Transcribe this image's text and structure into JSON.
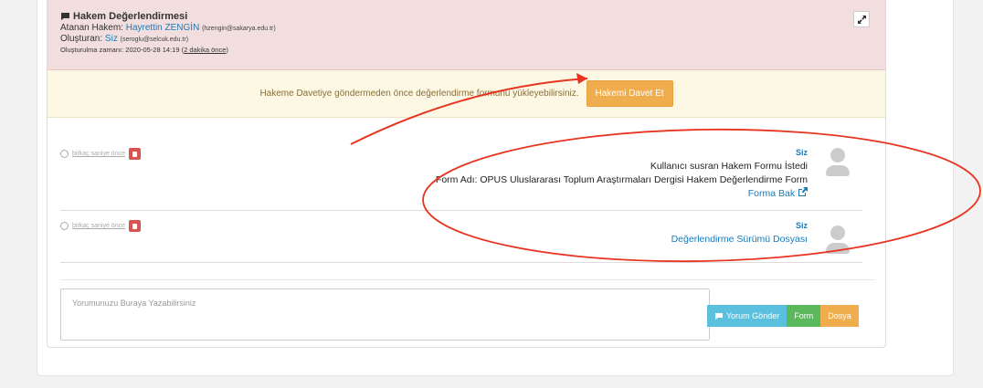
{
  "header": {
    "title": "Hakem Değerlendirmesi",
    "assigned_label": "Atanan Hakem:",
    "assigned_name": "Hayrettin ZENGİN",
    "assigned_email": "(hzengin@sakarya.edu.tr)",
    "creator_label": "Oluşturan:",
    "creator_name": "Siz",
    "creator_email": "(seroglu@selcuk.edu.tr)",
    "created_label": "Oluşturulma zamanı: 2020-05-28 14:19 (",
    "created_relative": "2 dakika önce",
    "created_suffix": ")"
  },
  "warning": {
    "message": "Hakeme Davetiye göndermeden önce değerlendirme formunu yükleyebilirsiniz.",
    "button": "Hakemi Davet Et"
  },
  "messages": [
    {
      "time": "birkaç saniye önce",
      "author": "Siz",
      "line1": "Kullanıcı susran Hakem Formu İstedi",
      "line2": "Form Adı: OPUS Uluslararası Toplum Araştırmaları Dergisi Hakem Değerlendirme Form",
      "link": "Forma Bak"
    },
    {
      "time": "birkaç saniye önce",
      "author": "Siz",
      "link": "Değerlendirme Sürümü Dosyası"
    }
  ],
  "composer": {
    "placeholder": "Yorumunuzu Buraya Yazabilirsiniz"
  },
  "buttons": {
    "send": "Yorum Gönder",
    "form": "Form",
    "file": "Dosya"
  },
  "colors": {
    "annotation": "#e8331f",
    "link": "#1a7ab9",
    "warning_bg": "#fcf8e3",
    "header_bg": "#f2dede"
  },
  "icons": [
    "comment-icon",
    "expand-icon",
    "clock-icon",
    "trash-icon",
    "external-link-icon",
    "avatar-icon",
    "send-icon"
  ]
}
